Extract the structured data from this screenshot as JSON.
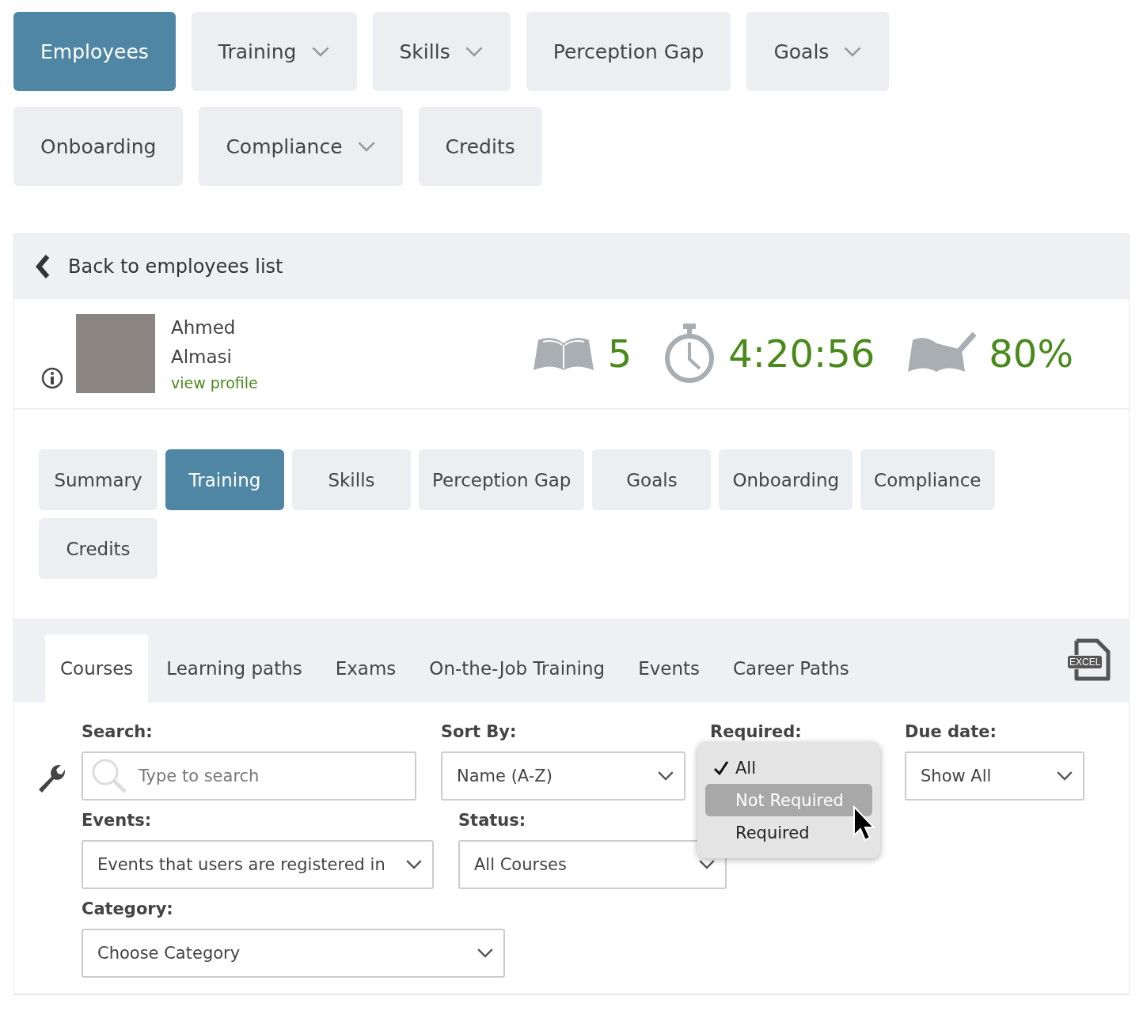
{
  "main_nav": [
    {
      "label": "Employees",
      "selected": true,
      "dropdown": false
    },
    {
      "label": "Training",
      "selected": false,
      "dropdown": true
    },
    {
      "label": "Skills",
      "selected": false,
      "dropdown": true
    },
    {
      "label": "Perception Gap",
      "selected": false,
      "dropdown": false
    },
    {
      "label": "Goals",
      "selected": false,
      "dropdown": true
    },
    {
      "label": "Onboarding",
      "selected": false,
      "dropdown": false
    },
    {
      "label": "Compliance",
      "selected": false,
      "dropdown": true
    },
    {
      "label": "Credits",
      "selected": false,
      "dropdown": false
    }
  ],
  "back_link": "Back to employees list",
  "employee": {
    "first_name": "Ahmed",
    "last_name": "Almasi",
    "profile_link": "view profile"
  },
  "stats": [
    {
      "kind": "courses",
      "value": "5"
    },
    {
      "kind": "time",
      "value": "4:20:56"
    },
    {
      "kind": "completion",
      "value": "80%"
    }
  ],
  "section_tabs": [
    {
      "label": "Summary",
      "selected": false
    },
    {
      "label": "Training",
      "selected": true
    },
    {
      "label": "Skills",
      "selected": false
    },
    {
      "label": "Perception Gap",
      "selected": false
    },
    {
      "label": "Goals",
      "selected": false
    },
    {
      "label": "Onboarding",
      "selected": false
    },
    {
      "label": "Compliance",
      "selected": false
    },
    {
      "label": "Credits",
      "selected": false
    }
  ],
  "training_tabs": [
    {
      "label": "Courses",
      "selected": true
    },
    {
      "label": "Learning paths",
      "selected": false
    },
    {
      "label": "Exams",
      "selected": false
    },
    {
      "label": "On-the-Job Training",
      "selected": false
    },
    {
      "label": "Events",
      "selected": false
    },
    {
      "label": "Career Paths",
      "selected": false
    }
  ],
  "export": {
    "label": "EXCEL"
  },
  "filters": {
    "search": {
      "label": "Search:",
      "placeholder": "Type to search"
    },
    "sort_by": {
      "label": "Sort By:",
      "value": "Name (A-Z)"
    },
    "required": {
      "label": "Required:",
      "options": [
        {
          "label": "All",
          "checked": true,
          "hovered": false
        },
        {
          "label": "Not Required",
          "checked": false,
          "hovered": true
        },
        {
          "label": "Required",
          "checked": false,
          "hovered": false
        }
      ]
    },
    "due_date": {
      "label": "Due date:",
      "value": "Show All"
    },
    "events": {
      "label": "Events:",
      "value": "Events that users are registered in"
    },
    "status": {
      "label": "Status:",
      "value": "All Courses"
    },
    "category": {
      "label": "Category:",
      "value": "Choose Category"
    }
  }
}
